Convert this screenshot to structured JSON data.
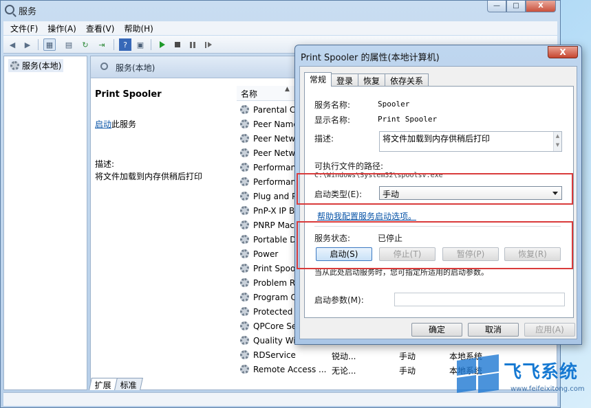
{
  "window": {
    "title": "服务",
    "buttons": {
      "minimize": "—",
      "maximize": "□",
      "close": "X"
    }
  },
  "menu": [
    "文件(F)",
    "操作(A)",
    "查看(V)",
    "帮助(H)"
  ],
  "tree": {
    "root": "服务(本地)"
  },
  "content": {
    "header": "服务(本地)",
    "service_title": "Print Spooler",
    "start_link": "启动",
    "start_suffix": "此服务",
    "desc_label": "描述:",
    "desc_text": "将文件加载到内存供稍后打印",
    "column_name": "名称",
    "sort_arrow": "▲",
    "services": [
      {
        "name": "Parental Co",
        "c2": "",
        "c3": "",
        "c4": ""
      },
      {
        "name": "Peer Name",
        "c2": "",
        "c3": "",
        "c4": ""
      },
      {
        "name": "Peer Netwo",
        "c2": "",
        "c3": "",
        "c4": ""
      },
      {
        "name": "Peer Netwo",
        "c2": "",
        "c3": "",
        "c4": ""
      },
      {
        "name": "Performan",
        "c2": "",
        "c3": "",
        "c4": ""
      },
      {
        "name": "Performan",
        "c2": "",
        "c3": "",
        "c4": ""
      },
      {
        "name": "Plug and P",
        "c2": "",
        "c3": "",
        "c4": ""
      },
      {
        "name": "PnP-X IP B",
        "c2": "",
        "c3": "",
        "c4": ""
      },
      {
        "name": "PNRP Mac",
        "c2": "",
        "c3": "",
        "c4": ""
      },
      {
        "name": "Portable D",
        "c2": "",
        "c3": "",
        "c4": ""
      },
      {
        "name": "Power",
        "c2": "",
        "c3": "",
        "c4": ""
      },
      {
        "name": "Print Spoo",
        "c2": "",
        "c3": "",
        "c4": ""
      },
      {
        "name": "Problem R",
        "c2": "",
        "c3": "",
        "c4": ""
      },
      {
        "name": "Program C",
        "c2": "",
        "c3": "",
        "c4": ""
      },
      {
        "name": "Protected S",
        "c2": "",
        "c3": "",
        "c4": ""
      },
      {
        "name": "QPCore Se",
        "c2": "",
        "c3": "",
        "c4": ""
      },
      {
        "name": "Quality Wi",
        "c2": "",
        "c3": "",
        "c4": ""
      },
      {
        "name": "RDService",
        "c2": "锐动...",
        "c3": "手动",
        "c4": "本地系统"
      },
      {
        "name": "Remote Access ...",
        "c2": "无论...",
        "c3": "手动",
        "c4": "本地系统"
      }
    ]
  },
  "bottom_tabs": [
    "扩展",
    "标准"
  ],
  "dialog": {
    "title": "Print Spooler 的属性(本地计算机)",
    "close": "X",
    "tabs": [
      "常规",
      "登录",
      "恢复",
      "依存关系"
    ],
    "service_name_label": "服务名称:",
    "service_name": "Spooler",
    "display_name_label": "显示名称:",
    "display_name": "Print Spooler",
    "description_label": "描述:",
    "description": "将文件加载到内存供稍后打印",
    "exe_path_label": "可执行文件的路径:",
    "exe_path": "C:\\Windows\\System32\\spoolsv.exe",
    "startup_type_label": "启动类型(E):",
    "startup_type": "手动",
    "help_link": "帮助我配置服务启动选项。",
    "status_label": "服务状态:",
    "status_value": "已停止",
    "btn_start": "启动(S)",
    "btn_stop": "停止(T)",
    "btn_pause": "暂停(P)",
    "btn_resume": "恢复(R)",
    "hint": "当从此处启动服务时，您可指定所适用的启动参数。",
    "param_label": "启动参数(M):",
    "param_value": "",
    "btn_ok": "确定",
    "btn_cancel": "取消",
    "btn_apply": "应用(A)"
  },
  "watermark": {
    "text": "飞飞系统",
    "url": "www.feifeixitong.com"
  },
  "colors": {
    "highlight": "#d93a3a",
    "link": "#0a55a8",
    "brand": "#1679d2"
  }
}
